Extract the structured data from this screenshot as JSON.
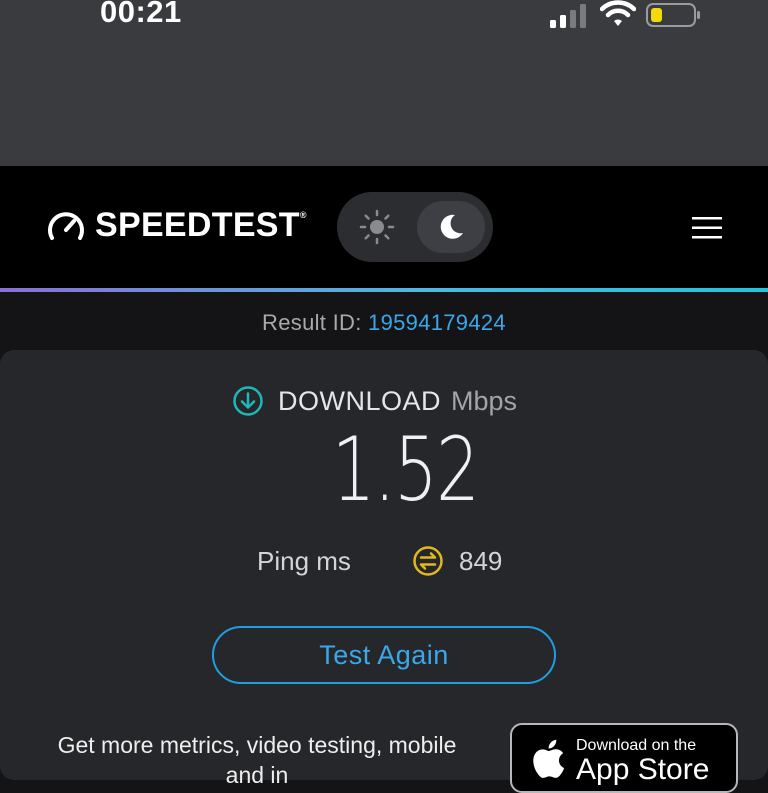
{
  "status_bar": {
    "time": "00:21"
  },
  "header": {
    "brand": "SPEEDTEST",
    "trademark": "®",
    "theme": "dark"
  },
  "result": {
    "label": "Result ID: ",
    "id": "19594179424"
  },
  "download": {
    "label": "DOWNLOAD",
    "unit": "Mbps",
    "value": "1.52"
  },
  "ping": {
    "label": "Ping ms",
    "value": "849"
  },
  "actions": {
    "test_again_label": "Test Again"
  },
  "promo": {
    "line1": "Get more metrics, video testing, mobile",
    "line2": "and in"
  },
  "app_store": {
    "small_text": "Download on the",
    "big_text": "App Store"
  },
  "colors": {
    "accent_blue": "#3aa8e8",
    "download_teal": "#1fb8b8",
    "ping_yellow": "#e2b81f",
    "header_bg": "#000000",
    "card_bg": "#26272b"
  }
}
